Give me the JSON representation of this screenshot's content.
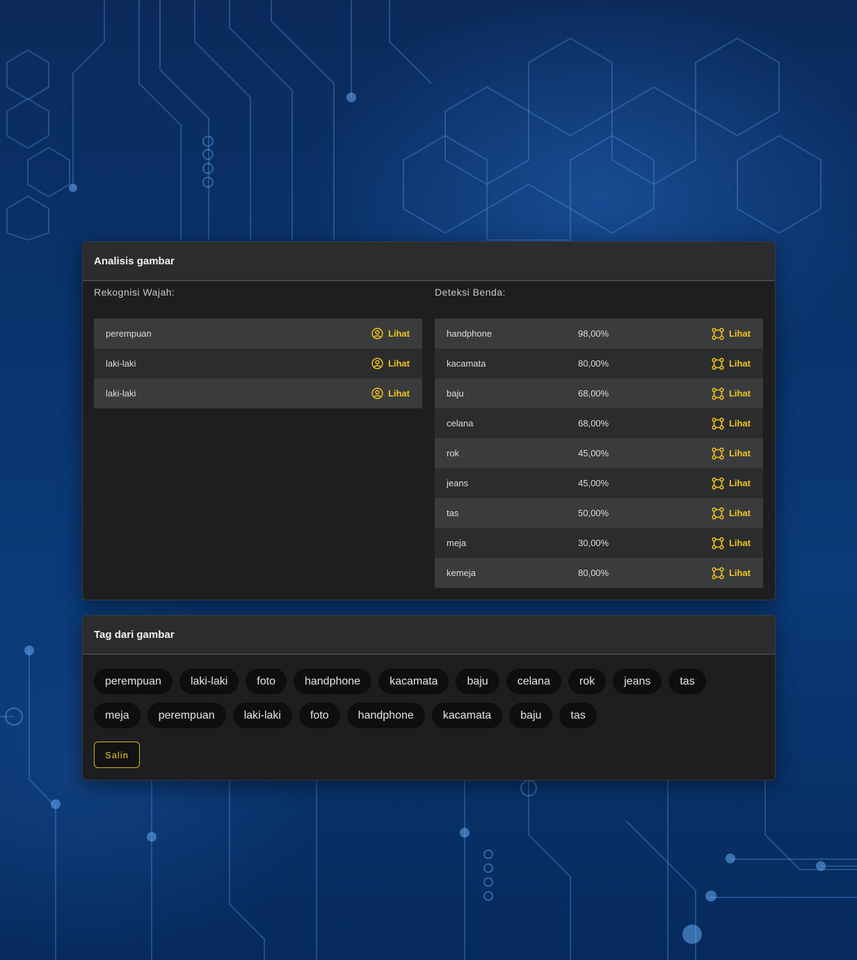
{
  "analysis": {
    "title": "Analisis gambar",
    "faces": {
      "title": "Rekognisi Wajah:",
      "rows": [
        {
          "label": "perempuan",
          "action": "Lihat",
          "icon": "user-circle-icon"
        },
        {
          "label": "laki-laki",
          "action": "Lihat",
          "icon": "user-circle-icon"
        },
        {
          "label": "laki-laki",
          "action": "Lihat",
          "icon": "user-circle-icon"
        }
      ]
    },
    "objects": {
      "title": "Deteksi Benda:",
      "rows": [
        {
          "label": "handphone",
          "confidence": "98,00%",
          "action": "Lihat",
          "icon": "bounding-box-icon"
        },
        {
          "label": "kacamata",
          "confidence": "80,00%",
          "action": "Lihat",
          "icon": "bounding-box-icon"
        },
        {
          "label": "baju",
          "confidence": "68,00%",
          "action": "Lihat",
          "icon": "bounding-box-icon"
        },
        {
          "label": "celana",
          "confidence": "68,00%",
          "action": "Lihat",
          "icon": "bounding-box-icon"
        },
        {
          "label": "rok",
          "confidence": "45,00%",
          "action": "Lihat",
          "icon": "bounding-box-icon"
        },
        {
          "label": "jeans",
          "confidence": "45,00%",
          "action": "Lihat",
          "icon": "bounding-box-icon"
        },
        {
          "label": "tas",
          "confidence": "50,00%",
          "action": "Lihat",
          "icon": "bounding-box-icon"
        },
        {
          "label": "meja",
          "confidence": "30,00%",
          "action": "Lihat",
          "icon": "bounding-box-icon"
        },
        {
          "label": "kemeja",
          "confidence": "80,00%",
          "action": "Lihat",
          "icon": "bounding-box-icon"
        }
      ]
    }
  },
  "tags_panel": {
    "title": "Tag dari gambar",
    "rows": [
      [
        "perempuan",
        "laki-laki",
        "foto",
        "handphone",
        "kacamata",
        "baju",
        "celana",
        "rok",
        "jeans",
        "tas"
      ],
      [
        "meja",
        "perempuan",
        "laki-laki",
        "foto",
        "handphone",
        "kacamata",
        "baju",
        "tas"
      ]
    ],
    "copy_label": "Salin"
  },
  "colors": {
    "accent": "#f0c419",
    "panel_bg": "#1d1e20",
    "header_bg": "#2b2c2e",
    "row_light": "#3a3b3d",
    "row_dark": "#2b2c2e",
    "tag_bg": "#0d0e0f",
    "background": "#0a3570"
  }
}
